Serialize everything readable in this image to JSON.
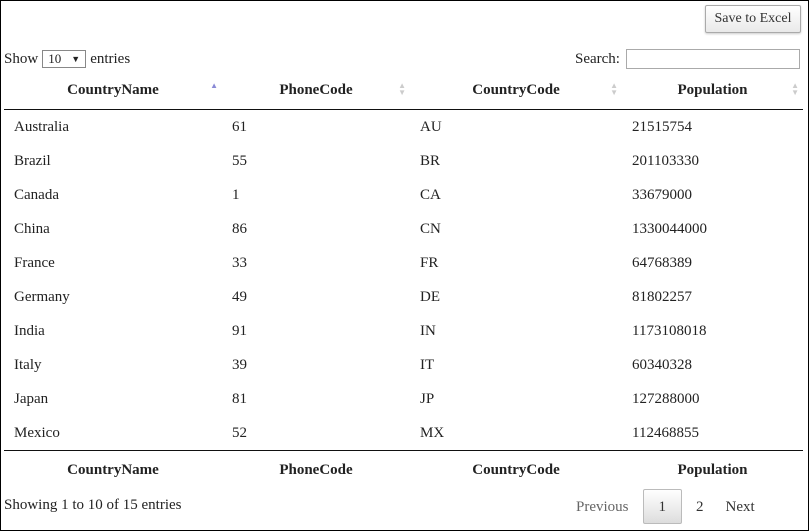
{
  "toolbar": {
    "save_label": "Save to Excel"
  },
  "length": {
    "show": "Show",
    "value": "10",
    "entries": "entries"
  },
  "search": {
    "label": "Search:",
    "value": ""
  },
  "columns": [
    "CountryName",
    "PhoneCode",
    "CountryCode",
    "Population"
  ],
  "sort": {
    "column": "CountryName",
    "direction": "ascending"
  },
  "rows": [
    [
      "Australia",
      "61",
      "AU",
      "21515754"
    ],
    [
      "Brazil",
      "55",
      "BR",
      "201103330"
    ],
    [
      "Canada",
      "1",
      "CA",
      "33679000"
    ],
    [
      "China",
      "86",
      "CN",
      "1330044000"
    ],
    [
      "France",
      "33",
      "FR",
      "64768389"
    ],
    [
      "Germany",
      "49",
      "DE",
      "81802257"
    ],
    [
      "India",
      "91",
      "IN",
      "1173108018"
    ],
    [
      "Italy",
      "39",
      "IT",
      "60340328"
    ],
    [
      "Japan",
      "81",
      "JP",
      "127288000"
    ],
    [
      "Mexico",
      "52",
      "MX",
      "112468855"
    ]
  ],
  "info": "Showing 1 to 10 of 15 entries",
  "pagination": {
    "previous": "Previous",
    "pages": [
      "1",
      "2"
    ],
    "current": "1",
    "next": "Next"
  }
}
